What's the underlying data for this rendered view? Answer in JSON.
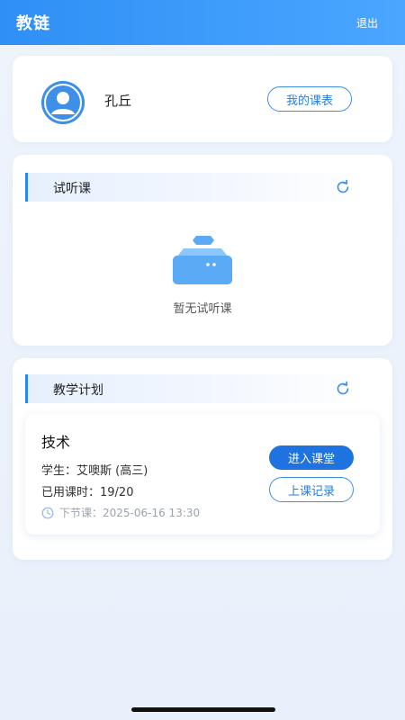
{
  "header": {
    "title": "教链",
    "logout_label": "退出"
  },
  "profile": {
    "name": "孔丘",
    "schedule_label": "我的课表",
    "avatar_icon": "user-avatar-icon"
  },
  "trial_section": {
    "title": "试听课",
    "refresh_icon": "refresh-icon",
    "empty_icon": "empty-box-icon",
    "empty_text": "暂无试听课"
  },
  "plan_section": {
    "title": "教学计划",
    "refresh_icon": "refresh-icon",
    "course": {
      "title": "技术",
      "student": "学生：艾噢斯 (高三)",
      "hours": "已用课时：19/20",
      "next_lesson": "下节课：2025-06-16 13:30",
      "enter_label": "进入课堂",
      "record_label": "上课记录"
    }
  },
  "colors": {
    "primary": "#2f8ff5",
    "button": "#1e73e0",
    "background": "#eef4fc"
  }
}
